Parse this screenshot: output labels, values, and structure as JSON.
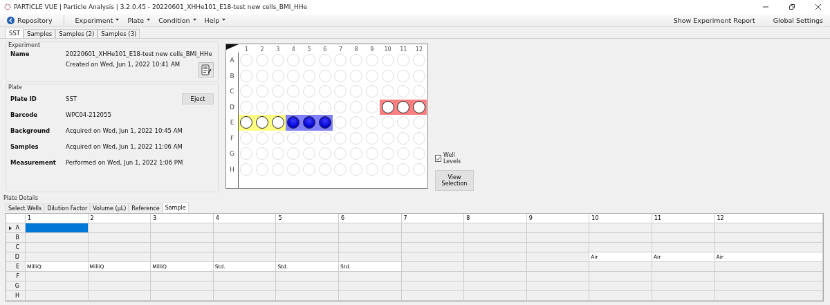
{
  "window": {
    "title": "PARTICLE VUE | Particle Analysis | 3.2.0.45 - 20220601_XHHe101_E18-test new cells_BMI_HHe"
  },
  "toolbar": {
    "repository": "Repository",
    "menus": [
      "Experiment",
      "Plate",
      "Condition",
      "Help"
    ],
    "right": [
      "Show Experiment Report",
      "Global Settings"
    ]
  },
  "tabs": [
    {
      "label": "SST",
      "selected": true
    },
    {
      "label": "Samples",
      "selected": false
    },
    {
      "label": "Samples (2)",
      "selected": false
    },
    {
      "label": "Samples (3)",
      "selected": false
    }
  ],
  "experiment": {
    "title": "Experiment",
    "name_label": "Name",
    "name": "20220601_XHHe101_E18-test new cells_BMI_HHe",
    "created": "Created on Wed, Jun 1, 2022 10:41 AM"
  },
  "plate": {
    "title": "Plate",
    "eject": "Eject",
    "fields": [
      {
        "label": "Plate ID",
        "value": "SST"
      },
      {
        "label": "Barcode",
        "value": "WPC04-212055"
      },
      {
        "label": "Background",
        "value": "Acquired on Wed, Jun 1, 2022 10:45 AM"
      },
      {
        "label": "Samples",
        "value": "Acquired on Wed, Jun 1, 2022 11:06 AM"
      },
      {
        "label": "Measurement",
        "value": "Performed on Wed, Jun 1, 2022 1:06 PM"
      }
    ]
  },
  "plate_map": {
    "columns": [
      "1",
      "2",
      "3",
      "4",
      "5",
      "6",
      "7",
      "8",
      "9",
      "10",
      "11",
      "12"
    ],
    "rows": [
      {
        "label": "A",
        "wells": [
          {
            "kind": "empty"
          },
          {
            "kind": "empty"
          },
          {
            "kind": "empty"
          },
          {
            "kind": "empty"
          },
          {
            "kind": "empty"
          },
          {
            "kind": "empty"
          },
          {
            "kind": "empty"
          },
          {
            "kind": "empty"
          },
          {
            "kind": "empty"
          },
          {
            "kind": "empty"
          },
          {
            "kind": "empty"
          },
          {
            "kind": "empty"
          }
        ]
      },
      {
        "label": "B",
        "wells": [
          {
            "kind": "empty"
          },
          {
            "kind": "empty"
          },
          {
            "kind": "empty"
          },
          {
            "kind": "empty"
          },
          {
            "kind": "empty"
          },
          {
            "kind": "empty"
          },
          {
            "kind": "empty"
          },
          {
            "kind": "empty"
          },
          {
            "kind": "empty"
          },
          {
            "kind": "empty"
          },
          {
            "kind": "empty"
          },
          {
            "kind": "empty"
          }
        ]
      },
      {
        "label": "C",
        "wells": [
          {
            "kind": "empty"
          },
          {
            "kind": "empty"
          },
          {
            "kind": "empty"
          },
          {
            "kind": "empty"
          },
          {
            "kind": "empty"
          },
          {
            "kind": "empty"
          },
          {
            "kind": "empty"
          },
          {
            "kind": "empty"
          },
          {
            "kind": "empty"
          },
          {
            "kind": "empty"
          },
          {
            "kind": "empty"
          },
          {
            "kind": "empty"
          }
        ]
      },
      {
        "label": "D",
        "wells": [
          {
            "kind": "empty"
          },
          {
            "kind": "empty"
          },
          {
            "kind": "empty"
          },
          {
            "kind": "empty"
          },
          {
            "kind": "empty"
          },
          {
            "kind": "empty"
          },
          {
            "kind": "empty"
          },
          {
            "kind": "empty"
          },
          {
            "kind": "empty"
          },
          {
            "kind": "clear",
            "color": "#ff8080"
          },
          {
            "kind": "clear",
            "color": "#ff8080"
          },
          {
            "kind": "clear",
            "color": "#ff8080"
          }
        ]
      },
      {
        "label": "E",
        "wells": [
          {
            "kind": "clear",
            "color": "#ffff80"
          },
          {
            "kind": "clear",
            "color": "#ffff80"
          },
          {
            "kind": "clear",
            "color": "#ffff80"
          },
          {
            "kind": "filled",
            "color": "#8080ff"
          },
          {
            "kind": "filled",
            "color": "#8080ff"
          },
          {
            "kind": "filled",
            "color": "#8080ff"
          },
          {
            "kind": "empty"
          },
          {
            "kind": "empty"
          },
          {
            "kind": "empty"
          },
          {
            "kind": "empty"
          },
          {
            "kind": "empty"
          },
          {
            "kind": "empty"
          }
        ]
      },
      {
        "label": "F",
        "wells": [
          {
            "kind": "empty"
          },
          {
            "kind": "empty"
          },
          {
            "kind": "empty"
          },
          {
            "kind": "empty"
          },
          {
            "kind": "empty"
          },
          {
            "kind": "empty"
          },
          {
            "kind": "empty"
          },
          {
            "kind": "empty"
          },
          {
            "kind": "empty"
          },
          {
            "kind": "empty"
          },
          {
            "kind": "empty"
          },
          {
            "kind": "empty"
          }
        ]
      },
      {
        "label": "G",
        "wells": [
          {
            "kind": "empty"
          },
          {
            "kind": "empty"
          },
          {
            "kind": "empty"
          },
          {
            "kind": "empty"
          },
          {
            "kind": "empty"
          },
          {
            "kind": "empty"
          },
          {
            "kind": "empty"
          },
          {
            "kind": "empty"
          },
          {
            "kind": "empty"
          },
          {
            "kind": "empty"
          },
          {
            "kind": "empty"
          },
          {
            "kind": "empty"
          }
        ]
      },
      {
        "label": "H",
        "wells": [
          {
            "kind": "empty"
          },
          {
            "kind": "empty"
          },
          {
            "kind": "empty"
          },
          {
            "kind": "empty"
          },
          {
            "kind": "empty"
          },
          {
            "kind": "empty"
          },
          {
            "kind": "empty"
          },
          {
            "kind": "empty"
          },
          {
            "kind": "empty"
          },
          {
            "kind": "empty"
          },
          {
            "kind": "empty"
          },
          {
            "kind": "empty"
          }
        ]
      }
    ]
  },
  "well_levels": {
    "label": "Well Levels",
    "checked": true
  },
  "view_selection": "View Selection",
  "plate_details": {
    "title": "Plate Details",
    "tabs": [
      {
        "label": "Select Wells",
        "selected": false
      },
      {
        "label": "Dilution Factor",
        "selected": false
      },
      {
        "label": "Volume (µL)",
        "selected": false
      },
      {
        "label": "Reference",
        "selected": false
      },
      {
        "label": "Sample",
        "selected": true
      }
    ],
    "columns": [
      "1",
      "2",
      "3",
      "4",
      "5",
      "6",
      "7",
      "8",
      "9",
      "10",
      "11",
      "12"
    ],
    "rows": [
      {
        "label": "A",
        "current": true,
        "cells": [
          {
            "text": "",
            "selected": true
          },
          {
            "text": "",
            "selected": false
          },
          {
            "text": "",
            "selected": false
          },
          {
            "text": "",
            "selected": false
          },
          {
            "text": "",
            "selected": false
          },
          {
            "text": "",
            "selected": false
          },
          {
            "text": "",
            "selected": false
          },
          {
            "text": "",
            "selected": false
          },
          {
            "text": "",
            "selected": false
          },
          {
            "text": "",
            "selected": false
          },
          {
            "text": "",
            "selected": false
          },
          {
            "text": "",
            "selected": false
          }
        ]
      },
      {
        "label": "B",
        "current": false,
        "cells": [
          "",
          "",
          "",
          "",
          "",
          "",
          "",
          "",
          "",
          "",
          "",
          ""
        ]
      },
      {
        "label": "C",
        "current": false,
        "cells": [
          "",
          "",
          "",
          "",
          "",
          "",
          "",
          "",
          "",
          "",
          "",
          ""
        ]
      },
      {
        "label": "D",
        "current": false,
        "cells": [
          "",
          "",
          "",
          "",
          "",
          "",
          "",
          "",
          "",
          "Air",
          "Air",
          "Air"
        ]
      },
      {
        "label": "E",
        "current": false,
        "cells": [
          "MilliQ",
          "MilliQ",
          "MilliQ",
          "Std.",
          "Std.",
          "Std.",
          "",
          "",
          "",
          "",
          "",
          ""
        ]
      },
      {
        "label": "F",
        "current": false,
        "cells": [
          "",
          "",
          "",
          "",
          "",
          "",
          "",
          "",
          "",
          "",
          "",
          ""
        ]
      },
      {
        "label": "G",
        "current": false,
        "cells": [
          "",
          "",
          "",
          "",
          "",
          "",
          "",
          "",
          "",
          "",
          "",
          ""
        ]
      },
      {
        "label": "H",
        "current": false,
        "cells": [
          "",
          "",
          "",
          "",
          "",
          "",
          "",
          "",
          "",
          "",
          "",
          ""
        ]
      }
    ]
  }
}
